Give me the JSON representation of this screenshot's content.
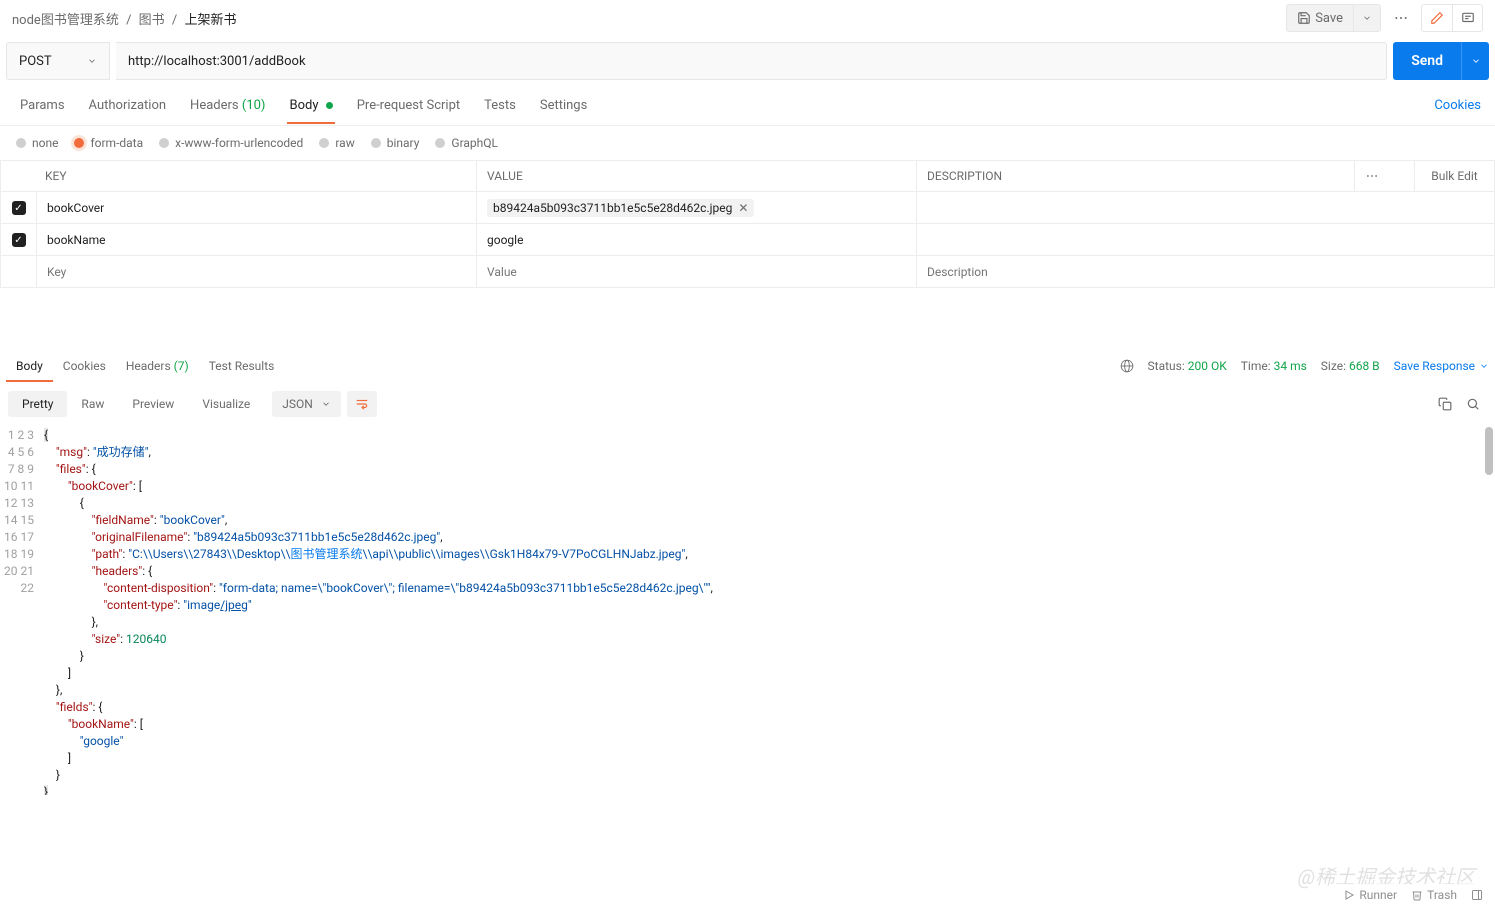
{
  "breadcrumb": {
    "root": "node图书管理系统",
    "mid": "图书",
    "current": "上架新书"
  },
  "topbar": {
    "save": "Save"
  },
  "request": {
    "method": "POST",
    "url": "http://localhost:3001/addBook",
    "send": "Send"
  },
  "reqTabs": {
    "params": "Params",
    "authorization": "Authorization",
    "headers": "Headers",
    "headersCount": "(10)",
    "body": "Body",
    "prerequest": "Pre-request Script",
    "tests": "Tests",
    "settings": "Settings",
    "cookies": "Cookies"
  },
  "bodyTypes": {
    "none": "none",
    "formdata": "form-data",
    "urlencoded": "x-www-form-urlencoded",
    "raw": "raw",
    "binary": "binary",
    "graphql": "GraphQL"
  },
  "kv": {
    "hKey": "KEY",
    "hValue": "VALUE",
    "hDesc": "DESCRIPTION",
    "bulk": "Bulk Edit",
    "rows": [
      {
        "key": "bookCover",
        "file": "b89424a5b093c3711bb1e5c5e28d462c.jpeg"
      },
      {
        "key": "bookName",
        "value": "google"
      }
    ],
    "phKey": "Key",
    "phValue": "Value",
    "phDesc": "Description"
  },
  "respTabs": {
    "body": "Body",
    "cookies": "Cookies",
    "headers": "Headers",
    "headersCount": "(7)",
    "testResults": "Test Results"
  },
  "respMeta": {
    "statusLabel": "Status:",
    "status": "200 OK",
    "timeLabel": "Time:",
    "time": "34 ms",
    "sizeLabel": "Size:",
    "size": "668 B",
    "saveResponse": "Save Response"
  },
  "viewTabs": {
    "pretty": "Pretty",
    "raw": "Raw",
    "preview": "Preview",
    "visualize": "Visualize",
    "lang": "JSON"
  },
  "code": {
    "msg": "成功存储",
    "r1key": "bookCover",
    "fieldName": "bookCover",
    "originalFilename": "b89424a5b093c3711bb1e5c5e28d462c.jpeg",
    "pathPrefix": "C:\\\\Users\\\\27843\\\\Desktop\\\\",
    "pathCJK": "图书管理系统",
    "pathSuffix": "\\\\api\\\\public\\\\images\\\\Gsk1H84x79-V7PoCGLHNJabz.jpeg",
    "cd": "form-data; name=\\\"bookCover\\\"; filename=\\\"b89424a5b093c3711bb1e5c5e28d462c.jpeg\\\"",
    "ctPrefix": "image",
    "ctSuffix": "/jpeg",
    "size": "120640",
    "bookNameVal": "google"
  },
  "footer": {
    "runner": "Runner",
    "trash": "Trash"
  },
  "watermark": "@稀土掘金技术社区"
}
